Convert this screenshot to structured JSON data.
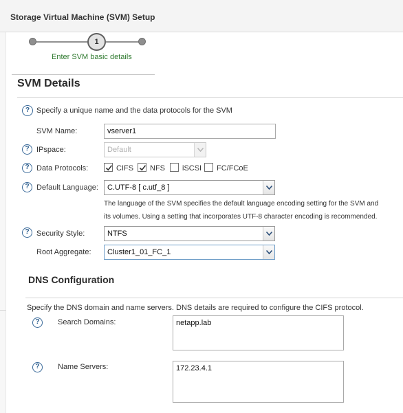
{
  "window": {
    "title": "Storage Virtual Machine (SVM) Setup"
  },
  "stepper": {
    "current_step": "1",
    "current_label": "Enter SVM basic details"
  },
  "section": {
    "title": "SVM Details"
  },
  "intro": {
    "text": "Specify a unique name and the data protocols for the SVM"
  },
  "svm_name": {
    "label": "SVM Name:",
    "value": "vserver1"
  },
  "ipspace": {
    "label": "IPspace:",
    "value": "Default",
    "disabled": true
  },
  "data_protocols": {
    "label": "Data Protocols:",
    "options": [
      {
        "label": "CIFS",
        "checked": true
      },
      {
        "label": "NFS",
        "checked": true
      },
      {
        "label": "iSCSI",
        "checked": false
      },
      {
        "label": "FC/FCoE",
        "checked": false
      }
    ]
  },
  "default_language": {
    "label": "Default Language:",
    "value": "C.UTF-8 [ c.utf_8 ]",
    "description_line1": "The language of the SVM specifies the default language encoding setting for the SVM and",
    "description_line2": "its volumes. Using a setting that incorporates UTF-8 character encoding is recommended."
  },
  "security_style": {
    "label": "Security Style:",
    "value": "NTFS"
  },
  "root_aggregate": {
    "label": "Root Aggregate:",
    "value": "Cluster1_01_FC_1"
  },
  "dns": {
    "title": "DNS Configuration",
    "description": "Specify the DNS domain and name servers. DNS details are required to configure the CIFS protocol.",
    "search_domains": {
      "label": "Search Domains:",
      "value": "netapp.lab"
    },
    "name_servers": {
      "label": "Name Servers:",
      "value": "172.23.4.1"
    }
  },
  "colors": {
    "accent_green": "#2f7a2f",
    "help_icon_blue": "#2d5f8f",
    "checkmark": "#333333"
  },
  "icons": {
    "help": "question-circle-icon",
    "dropdown": "chevron-down-icon",
    "check": "checkmark-icon"
  }
}
